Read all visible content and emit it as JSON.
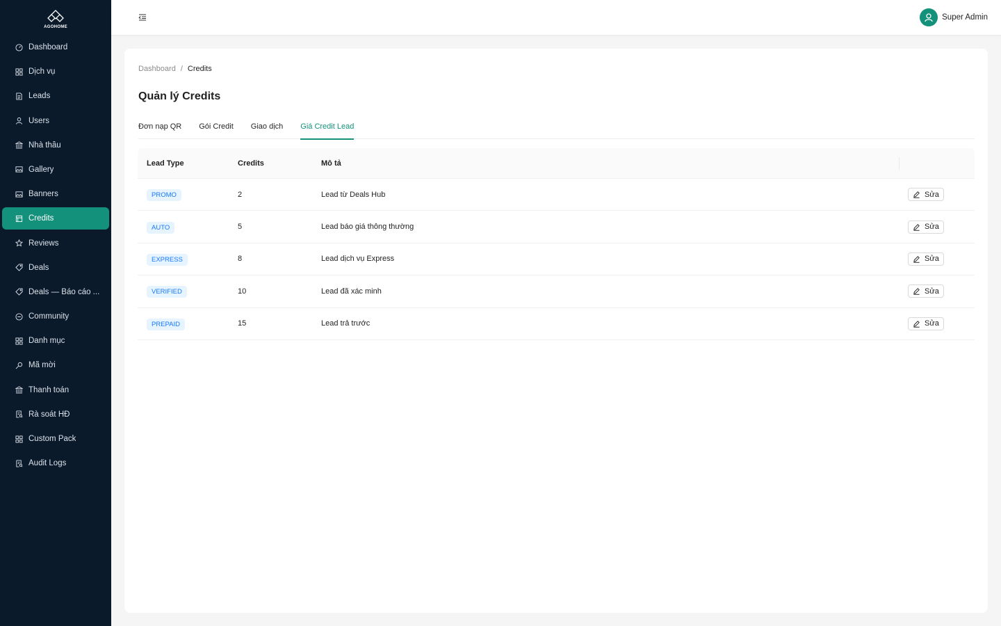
{
  "brand": {
    "name": "AGOHOME"
  },
  "sidebar": {
    "items": [
      {
        "label": "Dashboard",
        "icon": "dashboard-icon"
      },
      {
        "label": "Dịch vụ",
        "icon": "apps-icon"
      },
      {
        "label": "Leads",
        "icon": "file-icon"
      },
      {
        "label": "Users",
        "icon": "user-icon"
      },
      {
        "label": "Nhà thầu",
        "icon": "bank-icon"
      },
      {
        "label": "Gallery",
        "icon": "picture-icon"
      },
      {
        "label": "Banners",
        "icon": "picture-icon"
      },
      {
        "label": "Credits",
        "icon": "credit-icon",
        "active": true
      },
      {
        "label": "Reviews",
        "icon": "star-icon"
      },
      {
        "label": "Deals",
        "icon": "tag-icon"
      },
      {
        "label": "Deals — Báo cáo ...",
        "icon": "tag-icon"
      },
      {
        "label": "Community",
        "icon": "message-icon"
      },
      {
        "label": "Danh mục",
        "icon": "apps-icon"
      },
      {
        "label": "Mã mời",
        "icon": "key-icon"
      },
      {
        "label": "Thanh toán",
        "icon": "bank-icon"
      },
      {
        "label": "Rà soát HĐ",
        "icon": "audit-icon"
      },
      {
        "label": "Custom Pack",
        "icon": "apps-icon"
      },
      {
        "label": "Audit Logs",
        "icon": "audit-icon"
      }
    ]
  },
  "header": {
    "user_name": "Super Admin"
  },
  "breadcrumb": {
    "root": "Dashboard",
    "separator": "/",
    "current": "Credits"
  },
  "page": {
    "title": "Quản lý Credits"
  },
  "tabs": [
    {
      "label": "Đơn nạp QR"
    },
    {
      "label": "Gói Credit"
    },
    {
      "label": "Giao dịch"
    },
    {
      "label": "Giá Credit Lead",
      "active": true
    }
  ],
  "table": {
    "columns": [
      "Lead Type",
      "Credits",
      "Mô tả",
      ""
    ],
    "rows": [
      {
        "type": "PROMO",
        "credits": "2",
        "desc": "Lead từ Deals Hub",
        "action": "Sửa"
      },
      {
        "type": "AUTO",
        "credits": "5",
        "desc": "Lead báo giá thông thường",
        "action": "Sửa"
      },
      {
        "type": "EXPRESS",
        "credits": "8",
        "desc": "Lead dịch vụ Express",
        "action": "Sửa"
      },
      {
        "type": "VERIFIED",
        "credits": "10",
        "desc": "Lead đã xác minh",
        "action": "Sửa"
      },
      {
        "type": "PREPAID",
        "credits": "15",
        "desc": "Lead trả trước",
        "action": "Sửa"
      }
    ]
  },
  "colors": {
    "sidebar_bg": "#0b1a2b",
    "accent": "#13917b",
    "tag_text": "#1677ff",
    "tag_bg": "#e6f4ff"
  }
}
